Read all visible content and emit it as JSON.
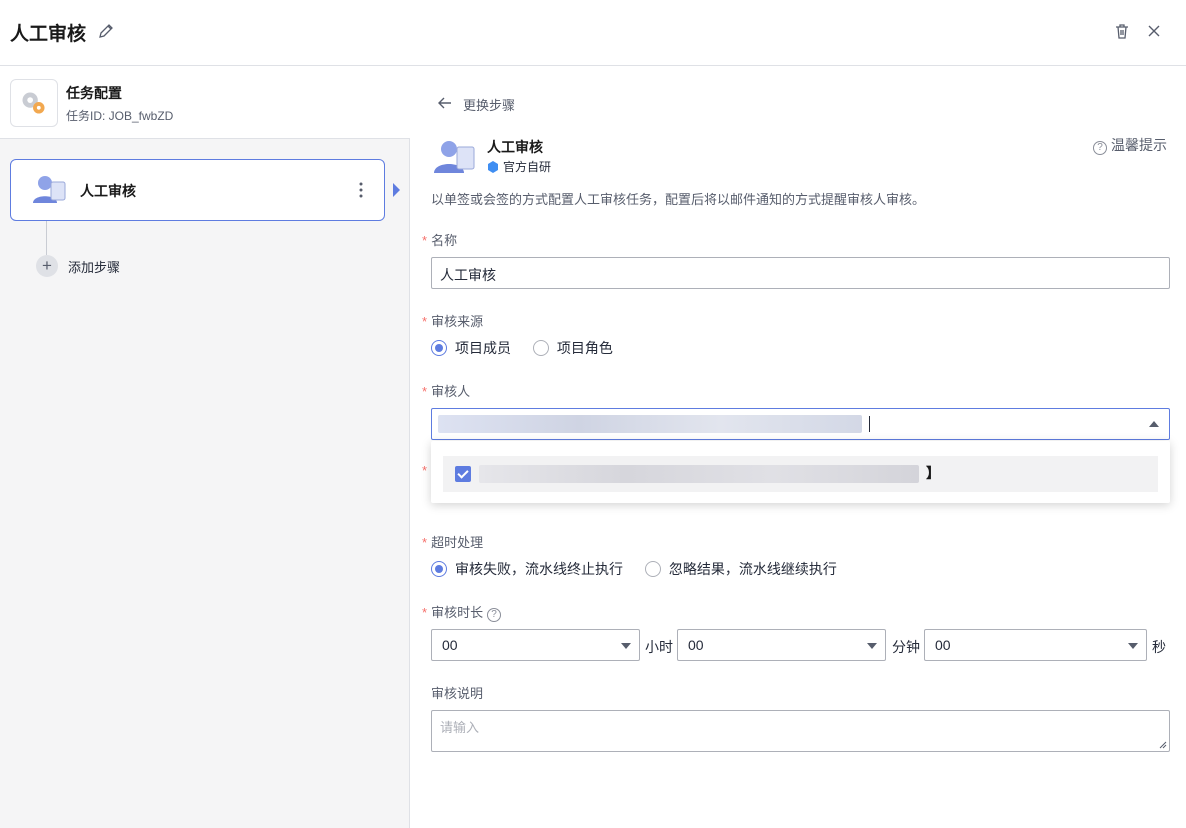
{
  "header": {
    "title": "人工审核",
    "edit_icon": "pencil-icon",
    "delete_icon": "trash-icon",
    "close_icon": "close-icon"
  },
  "sidebar": {
    "task_config": {
      "title": "任务配置",
      "id": "任务ID: JOB_fwbZD"
    },
    "steps": [
      {
        "label": "人工审核"
      }
    ],
    "add_step_label": "添加步骤"
  },
  "panel": {
    "back_label": "更换步骤",
    "step_name": "人工审核",
    "badge": "官方自研",
    "tip_label": "温馨提示",
    "description": "以单签或会签的方式配置人工审核任务，配置后将以邮件通知的方式提醒审核人审核。",
    "name_field": {
      "label": "名称",
      "value": "人工审核"
    },
    "source": {
      "label": "审核来源",
      "options": [
        "项目成员",
        "项目角色"
      ],
      "selected": "项目成员"
    },
    "reviewer": {
      "label": "审核人"
    },
    "timeout": {
      "label": "超时处理",
      "options": [
        "审核失败，流水线终止执行",
        "忽略结果，流水线继续执行"
      ],
      "selected": "审核失败，流水线终止执行"
    },
    "duration": {
      "label": "审核时长",
      "hours": "00",
      "hours_unit": "小时",
      "minutes": "00",
      "minutes_unit": "分钟",
      "seconds": "00",
      "seconds_unit": "秒"
    },
    "comment": {
      "label": "审核说明",
      "placeholder": "请输入"
    }
  },
  "colors": {
    "accent": "#5e7ce0",
    "required": "#f66f6a"
  }
}
